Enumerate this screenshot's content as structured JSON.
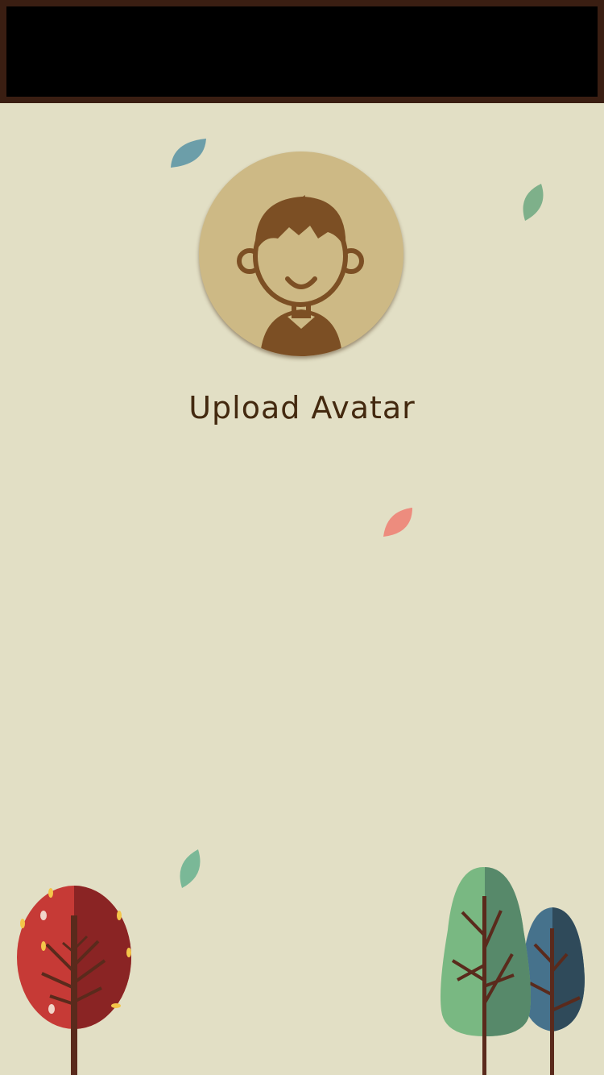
{
  "header": {
    "background_color": "#000000",
    "border_color": "#3a1e12"
  },
  "avatar": {
    "icon": "user-avatar-icon",
    "circle_color": "#cdb985",
    "figure_color": "#7c4f24"
  },
  "upload": {
    "label": "Upload Avatar",
    "color": "#43290f"
  },
  "decorations": {
    "leaves": [
      {
        "icon": "leaf-icon",
        "color": "#6c9ea9"
      },
      {
        "icon": "leaf-icon",
        "color": "#7eb08a"
      },
      {
        "icon": "leaf-icon",
        "color": "#ed8c7e"
      },
      {
        "icon": "leaf-icon",
        "color": "#7ab897"
      }
    ],
    "trees": [
      {
        "icon": "red-tree-icon",
        "color": "#c63a36"
      },
      {
        "icon": "green-tree-icon",
        "color": "#79b882"
      },
      {
        "icon": "blue-tree-icon",
        "color": "#46728c"
      }
    ]
  },
  "page": {
    "background_color": "#e2dfc5"
  }
}
